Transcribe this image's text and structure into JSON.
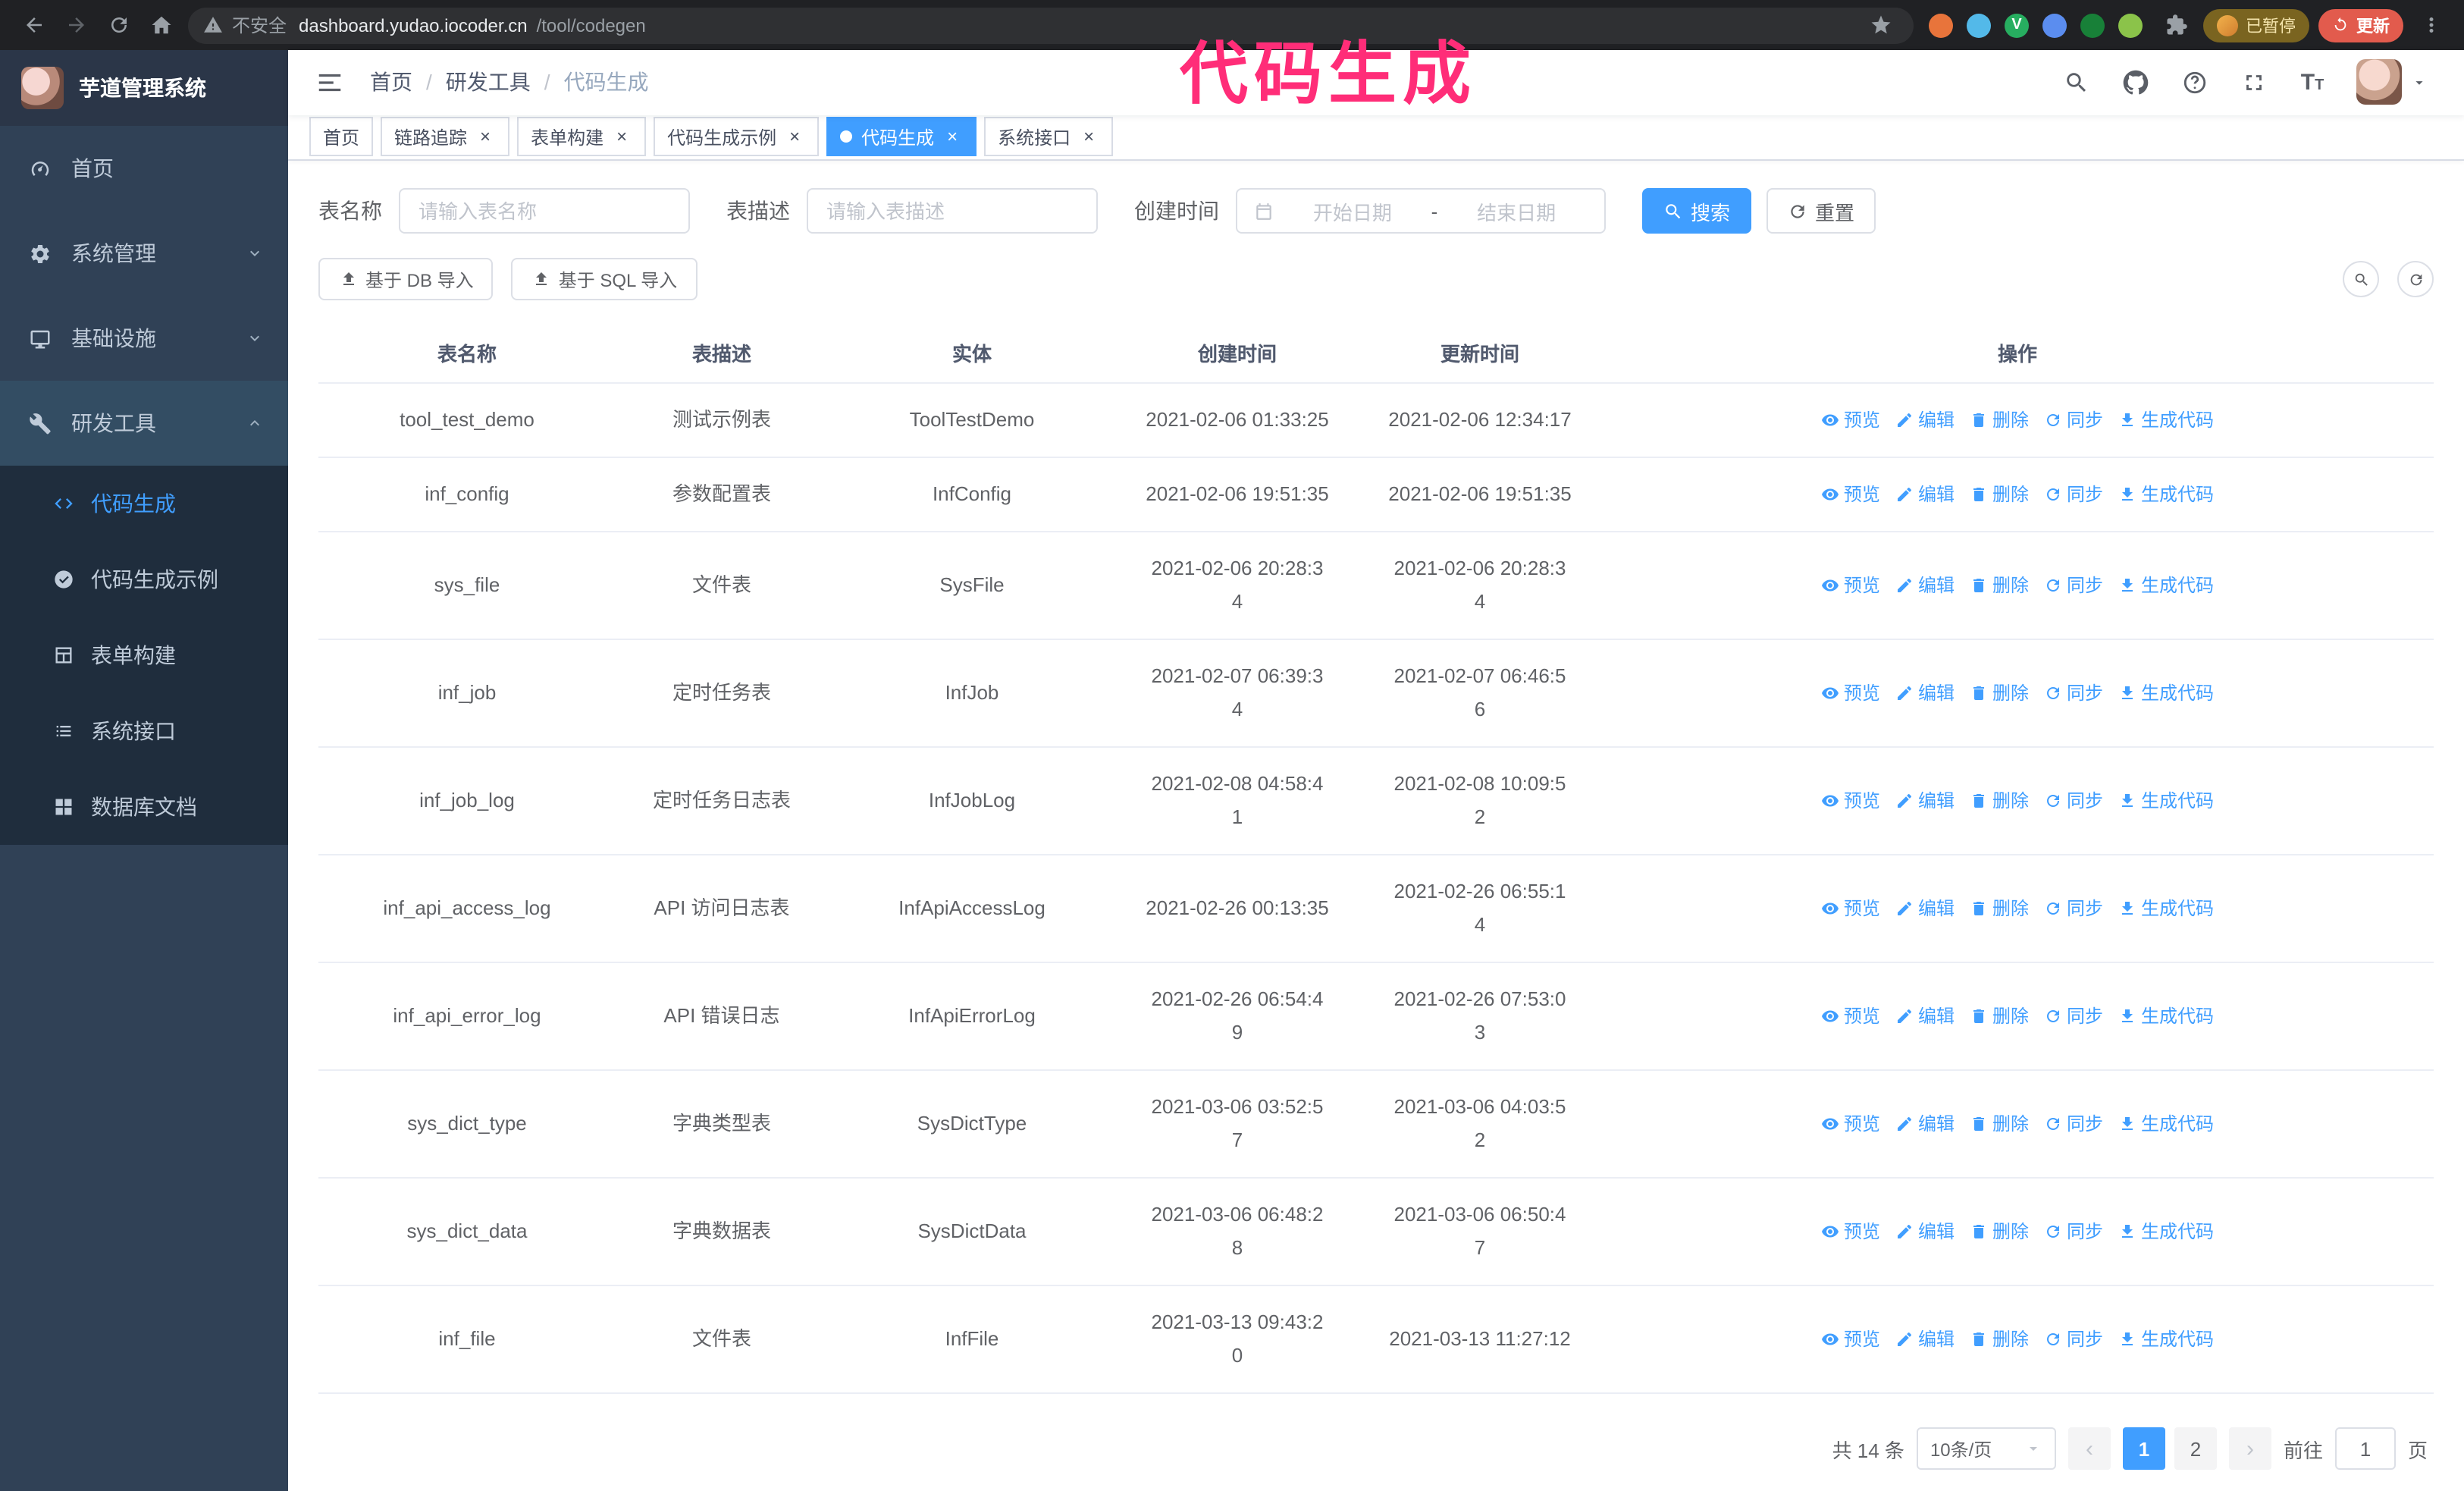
{
  "colors": {
    "accent": "#409eff",
    "annotation": "#ff2d78",
    "sidebar_bg": "#304156",
    "submenu_bg": "#1f2d3d"
  },
  "annotation": {
    "text": "代码生成"
  },
  "browser": {
    "nav_icons": [
      "back-icon",
      "forward-icon",
      "reload-icon",
      "home-icon"
    ],
    "security_label": "不安全",
    "url_host": "dashboard.yudao.iocoder.cn",
    "url_path": "/tool/codegen",
    "extensions": [
      {
        "name": "fox-extension-icon",
        "color": "#e8743b",
        "glyph": ""
      },
      {
        "name": "water-drop-extension-icon",
        "color": "#53b9e9",
        "glyph": ""
      },
      {
        "name": "v-badge-extension-icon",
        "color": "#27ae60",
        "glyph": "V"
      },
      {
        "name": "contacts-extension-icon",
        "color": "#5b8def",
        "glyph": ""
      },
      {
        "name": "sheets-extension-icon",
        "color": "#188038",
        "glyph": ""
      },
      {
        "name": "paw-extension-icon",
        "color": "#8bc34a",
        "glyph": ""
      }
    ],
    "paused_badge": "已暂停",
    "update_button": "更新"
  },
  "sidebar": {
    "logo_title": "芋道管理系统",
    "items": [
      {
        "id": "home",
        "label": "首页",
        "icon": "dashboard-icon",
        "expandable": false,
        "expanded": false
      },
      {
        "id": "system",
        "label": "系统管理",
        "icon": "gear-icon",
        "expandable": true,
        "expanded": false
      },
      {
        "id": "infrastructure",
        "label": "基础设施",
        "icon": "monitor-icon",
        "expandable": true,
        "expanded": false
      },
      {
        "id": "devtools",
        "label": "研发工具",
        "icon": "tools-icon",
        "expandable": true,
        "expanded": true
      }
    ],
    "submenu": [
      {
        "id": "codegen",
        "label": "代码生成",
        "icon": "code-icon",
        "active": true
      },
      {
        "id": "codegen-example",
        "label": "代码生成示例",
        "icon": "example-icon",
        "active": false
      },
      {
        "id": "form-builder",
        "label": "表单构建",
        "icon": "form-icon",
        "active": false
      },
      {
        "id": "system-api",
        "label": "系统接口",
        "icon": "api-icon",
        "active": false
      },
      {
        "id": "db-doc",
        "label": "数据库文档",
        "icon": "db-doc-icon",
        "active": false
      }
    ]
  },
  "navbar": {
    "breadcrumb": [
      "首页",
      "研发工具",
      "代码生成"
    ],
    "right_icons": [
      "search-icon",
      "github-icon",
      "question-icon",
      "fullscreen-icon",
      "font-size-icon"
    ]
  },
  "tabs": [
    {
      "label": "首页",
      "closable": false,
      "active": false
    },
    {
      "label": "链路追踪",
      "closable": true,
      "active": false
    },
    {
      "label": "表单构建",
      "closable": true,
      "active": false
    },
    {
      "label": "代码生成示例",
      "closable": true,
      "active": false
    },
    {
      "label": "代码生成",
      "closable": true,
      "active": true
    },
    {
      "label": "系统接口",
      "closable": true,
      "active": false
    }
  ],
  "filters": {
    "table_name_label": "表名称",
    "table_name_placeholder": "请输入表名称",
    "table_desc_label": "表描述",
    "table_desc_placeholder": "请输入表描述",
    "create_time_label": "创建时间",
    "start_date_placeholder": "开始日期",
    "range_separator": "-",
    "end_date_placeholder": "结束日期",
    "search_button": "搜索",
    "reset_button": "重置"
  },
  "toolbar": {
    "import_db_button": "基于 DB 导入",
    "import_sql_button": "基于 SQL 导入"
  },
  "table": {
    "columns": [
      "表名称",
      "表描述",
      "实体",
      "创建时间",
      "更新时间",
      "操作"
    ],
    "actions": [
      {
        "label": "预览",
        "icon": "eye-icon"
      },
      {
        "label": "编辑",
        "icon": "edit-icon"
      },
      {
        "label": "删除",
        "icon": "delete-icon"
      },
      {
        "label": "同步",
        "icon": "sync-icon"
      },
      {
        "label": "生成代码",
        "icon": "download-icon"
      }
    ],
    "rows": [
      {
        "name": "tool_test_demo",
        "desc": "测试示例表",
        "entity": "ToolTestDemo",
        "create_time": "2021-02-06 01:33:25",
        "update_time": "2021-02-06 12:34:17"
      },
      {
        "name": "inf_config",
        "desc": "参数配置表",
        "entity": "InfConfig",
        "create_time": "2021-02-06 19:51:35",
        "update_time": "2021-02-06 19:51:35"
      },
      {
        "name": "sys_file",
        "desc": "文件表",
        "entity": "SysFile",
        "create_time": "2021-02-06 20:28:3\n4",
        "update_time": "2021-02-06 20:28:3\n4"
      },
      {
        "name": "inf_job",
        "desc": "定时任务表",
        "entity": "InfJob",
        "create_time": "2021-02-07 06:39:3\n4",
        "update_time": "2021-02-07 06:46:5\n6"
      },
      {
        "name": "inf_job_log",
        "desc": "定时任务日志表",
        "entity": "InfJobLog",
        "create_time": "2021-02-08 04:58:4\n1",
        "update_time": "2021-02-08 10:09:5\n2"
      },
      {
        "name": "inf_api_access_log",
        "desc": "API 访问日志表",
        "entity": "InfApiAccessLog",
        "create_time": "2021-02-26 00:13:35",
        "update_time": "2021-02-26 06:55:1\n4"
      },
      {
        "name": "inf_api_error_log",
        "desc": "API 错误日志",
        "entity": "InfApiErrorLog",
        "create_time": "2021-02-26 06:54:4\n9",
        "update_time": "2021-02-26 07:53:0\n3"
      },
      {
        "name": "sys_dict_type",
        "desc": "字典类型表",
        "entity": "SysDictType",
        "create_time": "2021-03-06 03:52:5\n7",
        "update_time": "2021-03-06 04:03:5\n2"
      },
      {
        "name": "sys_dict_data",
        "desc": "字典数据表",
        "entity": "SysDictData",
        "create_time": "2021-03-06 06:48:2\n8",
        "update_time": "2021-03-06 06:50:4\n7"
      },
      {
        "name": "inf_file",
        "desc": "文件表",
        "entity": "InfFile",
        "create_time": "2021-03-13 09:43:2\n0",
        "update_time": "2021-03-13 11:27:12"
      }
    ]
  },
  "pagination": {
    "total_text": "共 14 条",
    "page_size_text": "10条/页",
    "pages": [
      "1",
      "2"
    ],
    "active_page": "1",
    "goto_prefix": "前往",
    "goto_value": "1",
    "goto_suffix": "页"
  }
}
